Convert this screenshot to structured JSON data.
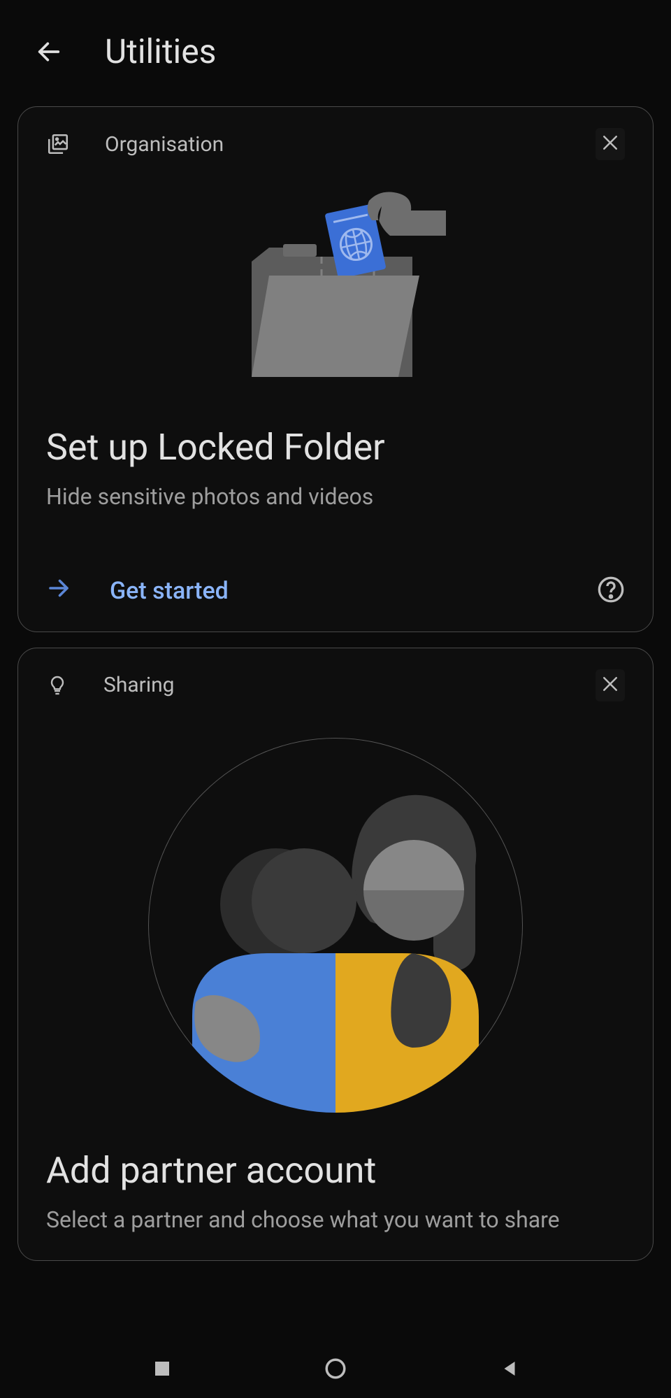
{
  "header": {
    "title": "Utilities"
  },
  "cards": [
    {
      "category": "Organisation",
      "title": "Set up Locked Folder",
      "subtitle": "Hide sensitive photos and videos",
      "action_label": "Get started"
    },
    {
      "category": "Sharing",
      "title": "Add partner account",
      "subtitle": "Select a partner and choose what you want to share"
    }
  ]
}
